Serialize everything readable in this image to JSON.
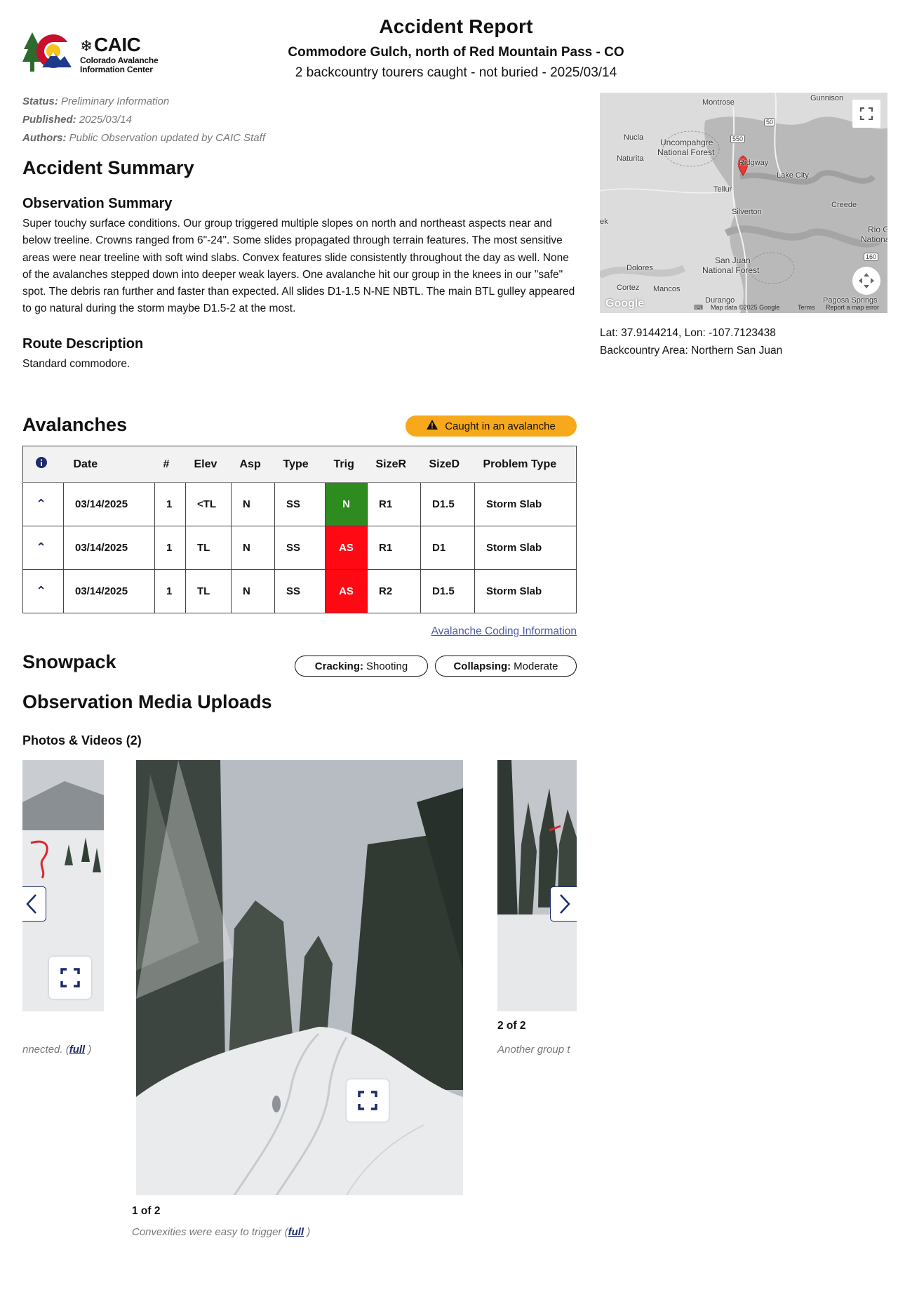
{
  "logo": {
    "acronym": "CAIC",
    "line1": "Colorado Avalanche",
    "line2": "Information Center"
  },
  "header": {
    "title": "Accident Report",
    "location": "Commodore Gulch, north of Red Mountain Pass - CO",
    "summary": "2 backcountry tourers caught - not buried - 2025/03/14"
  },
  "meta": {
    "status_label": "Status:",
    "status": "Preliminary Information",
    "published_label": "Published:",
    "published": "2025/03/14",
    "authors_label": "Authors:",
    "authors": "Public Observation updated by CAIC Staff"
  },
  "accident_summary": {
    "heading": "Accident Summary",
    "observation_heading": "Observation Summary",
    "observation_text": "Super touchy surface conditions. Our group triggered multiple slopes on north and northeast aspects near and below treeline. Crowns ranged from 6\"-24\". Some slides propagated through terrain features. The most sensitive areas were near treeline with soft wind slabs. Convex features slide consistently throughout the day as well. None of the avalanches stepped down into deeper weak layers. One avalanche hit our group in the knees in our \"safe\" spot. The debris ran further and faster than expected. All slides D1-1.5 N-NE NBTL. The main BTL gulley appeared to go natural during the storm maybe D1.5-2 at the most.",
    "route_heading": "Route Description",
    "route_text": "Standard commodore."
  },
  "avalanches": {
    "heading": "Avalanches",
    "badge": "Caught in an avalanche",
    "columns": [
      "Date",
      "#",
      "Elev",
      "Asp",
      "Type",
      "Trig",
      "SizeR",
      "SizeD",
      "Problem Type"
    ],
    "rows": [
      {
        "date": "03/14/2025",
        "num": "1",
        "elev": "<TL",
        "asp": "N",
        "type": "SS",
        "trig": "N",
        "sizer": "R1",
        "sized": "D1.5",
        "problem": "Storm Slab"
      },
      {
        "date": "03/14/2025",
        "num": "1",
        "elev": "TL",
        "asp": "N",
        "type": "SS",
        "trig": "AS",
        "sizer": "R1",
        "sized": "D1",
        "problem": "Storm Slab"
      },
      {
        "date": "03/14/2025",
        "num": "1",
        "elev": "TL",
        "asp": "N",
        "type": "SS",
        "trig": "AS",
        "sizer": "R2",
        "sized": "D1.5",
        "problem": "Storm Slab"
      }
    ],
    "trig_colors": {
      "N": "#2e8b1f",
      "AS": "#ff0a14"
    },
    "coding_link": "Avalanche Coding Information"
  },
  "snowpack": {
    "heading": "Snowpack",
    "cracking_label": "Cracking:",
    "cracking": "Shooting",
    "collapsing_label": "Collapsing:",
    "collapsing": "Moderate"
  },
  "media": {
    "heading": "Observation Media Uploads",
    "photos_heading": "Photos & Videos (2)",
    "prev_caption_tail": "nnected.",
    "full_link": "full",
    "current_index": "1 of 2",
    "current_caption": "Convexities were easy to trigger",
    "next_index": "2 of 2",
    "next_caption_head": "Another group t"
  },
  "map": {
    "labels": [
      "Montrose",
      "Gunnison",
      "Nucla",
      "Uncompahgre",
      "National Forest",
      "Naturita",
      "Ridgway",
      "Lake City",
      "Tellur",
      "Silverton",
      "Creede",
      "Rio Gr",
      "National",
      "Dolores",
      "San Juan",
      "National Forest",
      "Cortez",
      "Mancos",
      "Durango",
      "Pagosa Springs",
      "ek",
      "550",
      "50",
      "160"
    ],
    "attribution": "Map data ©2025 Google",
    "terms": "Terms",
    "report": "Report a map error",
    "google": "Google",
    "lat_lon": "Lat: 37.9144214, Lon: -107.7123438",
    "area": "Backcountry Area: Northern San Juan"
  }
}
